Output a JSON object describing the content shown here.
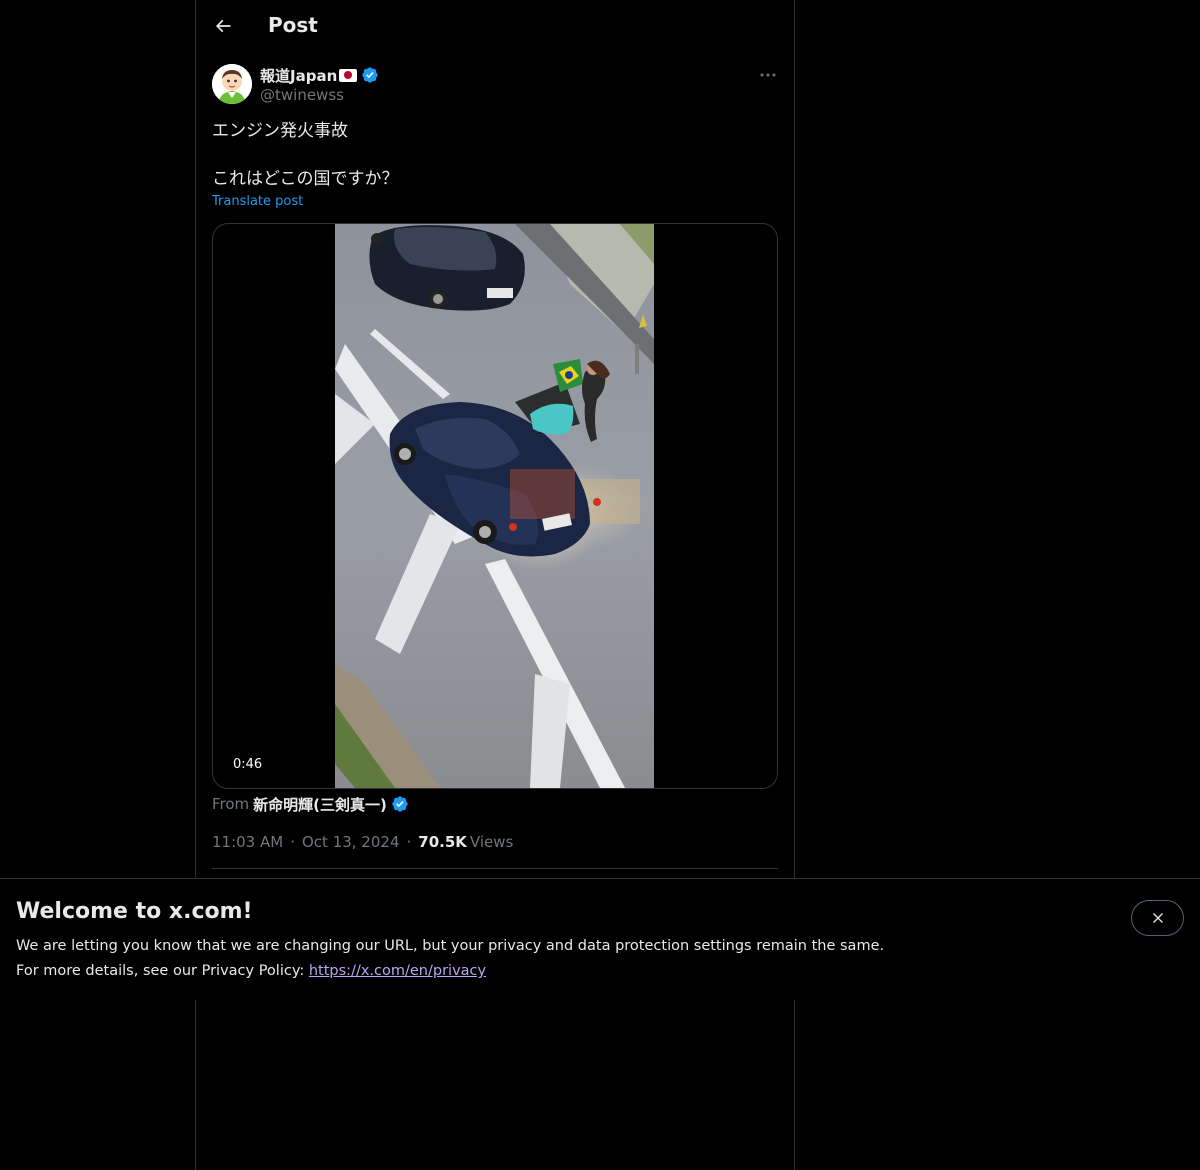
{
  "header": {
    "title": "Post",
    "back_icon": "arrow-left-icon"
  },
  "post": {
    "author": {
      "display_name": "報道Japan",
      "handle": "@twinewss",
      "flag_icon": "japan-flag-icon",
      "verified_icon": "verified-badge-icon"
    },
    "more_icon": "more-horizontal-icon",
    "text_lines": [
      "エンジン発火事故",
      "これはどこの国ですか？"
    ],
    "translate_label": "Translate post",
    "media": {
      "type": "video",
      "duration": "0:46"
    },
    "attribution": {
      "prefix": "From",
      "name": "新命明輝(三剣真一)"
    },
    "meta": {
      "time": "11:03 AM",
      "date": "Oct 13, 2024",
      "views_count": "70.5K",
      "views_label": "Views",
      "separator": "·"
    }
  },
  "banner": {
    "title": "Welcome to x.com!",
    "line1": "We are letting you know that we are changing our URL, but your privacy and data protection settings remain the same.",
    "line2_prefix": "For more details, see our Privacy Policy:",
    "link": "https://x.com/en/privacy",
    "close_icon": "close-icon"
  },
  "colors": {
    "background": "#000000",
    "text_primary": "#e7e9ea",
    "text_secondary": "#71767b",
    "accent": "#1d9bf0",
    "border": "#2f3336",
    "link_visited": "#b9a6f5"
  }
}
